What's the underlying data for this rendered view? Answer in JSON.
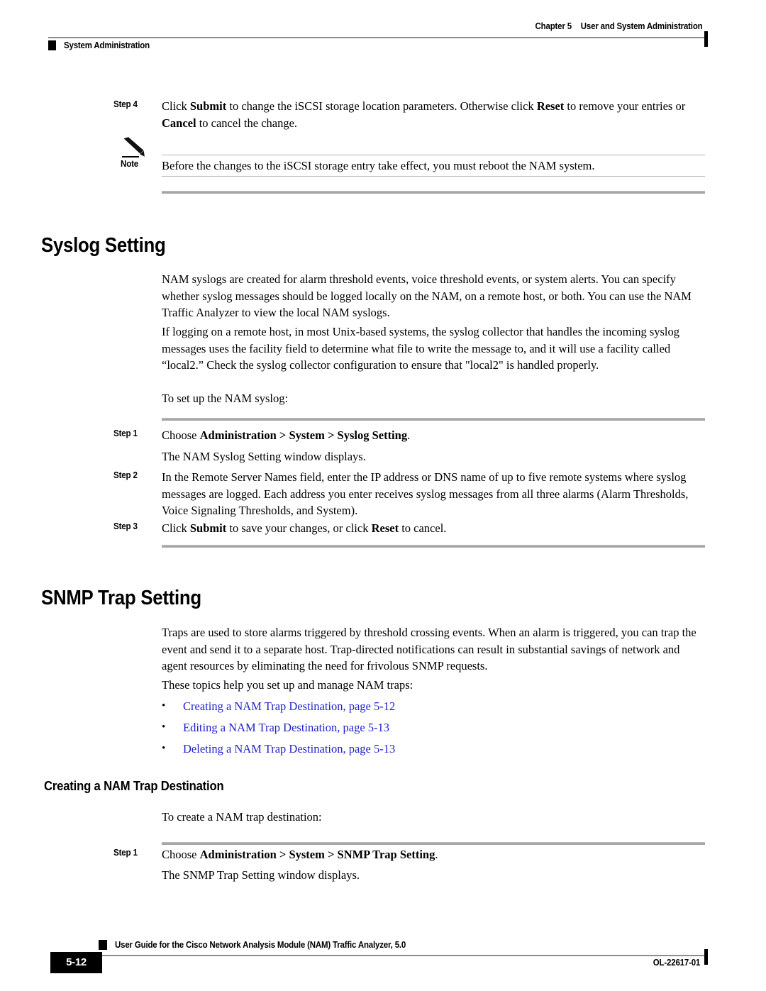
{
  "header": {
    "chapter_label": "Chapter 5",
    "chapter_title": "User and System Administration",
    "section_title": "System Administration"
  },
  "footer": {
    "page_number": "5-12",
    "guide_title": "User Guide for the Cisco Network Analysis Module (NAM) Traffic Analyzer, 5.0",
    "doc_id": "OL-22617-01"
  },
  "colors": {
    "link": "#2222cc",
    "rule": "#a6a6a6",
    "header_rule": "#8c8c8c",
    "text": "#000000"
  },
  "iscsi_step": {
    "label": "Step 4",
    "line1_pre": "Click ",
    "line1_b1": "Submit",
    "line1_mid": " to change the iSCSI storage location parameters. Otherwise click ",
    "line1_b2": "Reset",
    "line1_post": " to remove your entries or ",
    "line1_b3": "Cancel",
    "line1_end": " to cancel the change."
  },
  "note": {
    "icon": "pencil-icon",
    "label": "Note",
    "text": "Before the changes to the iSCSI storage entry take effect, you must reboot the NAM system."
  },
  "syslog": {
    "heading": "Syslog Setting",
    "para1": "NAM syslogs are created for alarm threshold events, voice threshold events, or system alerts. You can specify whether syslog messages should be logged locally on the NAM, on a remote host, or both. You can use the NAM Traffic Analyzer to view the local NAM syslogs.",
    "para2": "If logging on a remote host, in most Unix-based systems, the syslog collector that handles the incoming syslog messages uses the facility field to determine what file to write the message to, and it will use a facility called “local2.” Check the syslog collector configuration to ensure that \"local2\" is handled properly.",
    "para3": "To set up the NAM syslog:",
    "steps": [
      {
        "label": "Step 1",
        "pre": "Choose ",
        "bold": "Administration > System > Syslog Setting",
        "post": ".",
        "sub": "The NAM Syslog Setting window displays."
      },
      {
        "label": "Step 2",
        "pre": "In the Remote Server Names field, enter the IP address or DNS name of up to five remote systems where syslog messages are logged. Each address you enter receives syslog messages from all three alarms (Alarm Thresholds, Voice Signaling Thresholds, and System).",
        "bold": "",
        "post": "",
        "sub": ""
      },
      {
        "label": "Step 3",
        "pre": "Click ",
        "bold": "Submit",
        "mid": " to save your changes, or click ",
        "bold2": "Reset",
        "post": " to cancel.",
        "sub": ""
      }
    ]
  },
  "snmp": {
    "heading": "SNMP Trap Setting",
    "para1": "Traps are used to store alarms triggered by threshold crossing events. When an alarm is triggered, you can trap the event and send it to a separate host. Trap-directed notifications can result in substantial savings of network and agent resources by eliminating the need for frivolous SNMP requests.",
    "para2": "These topics help you set up and manage NAM traps:",
    "topics": [
      {
        "bullet": "•",
        "text": "Creating a NAM Trap Destination, page 5-12"
      },
      {
        "bullet": "•",
        "text": "Editing a NAM Trap Destination, page 5-13"
      },
      {
        "bullet": "•",
        "text": "Deleting a NAM Trap Destination, page 5-13"
      }
    ],
    "subheading": "Creating a NAM Trap Destination",
    "intro": "To create a NAM trap destination:",
    "step": {
      "label": "Step 1",
      "pre": "Choose ",
      "bold": "Administration > System > SNMP Trap Setting",
      "post": ".",
      "sub": "The SNMP Trap Setting window displays."
    }
  }
}
